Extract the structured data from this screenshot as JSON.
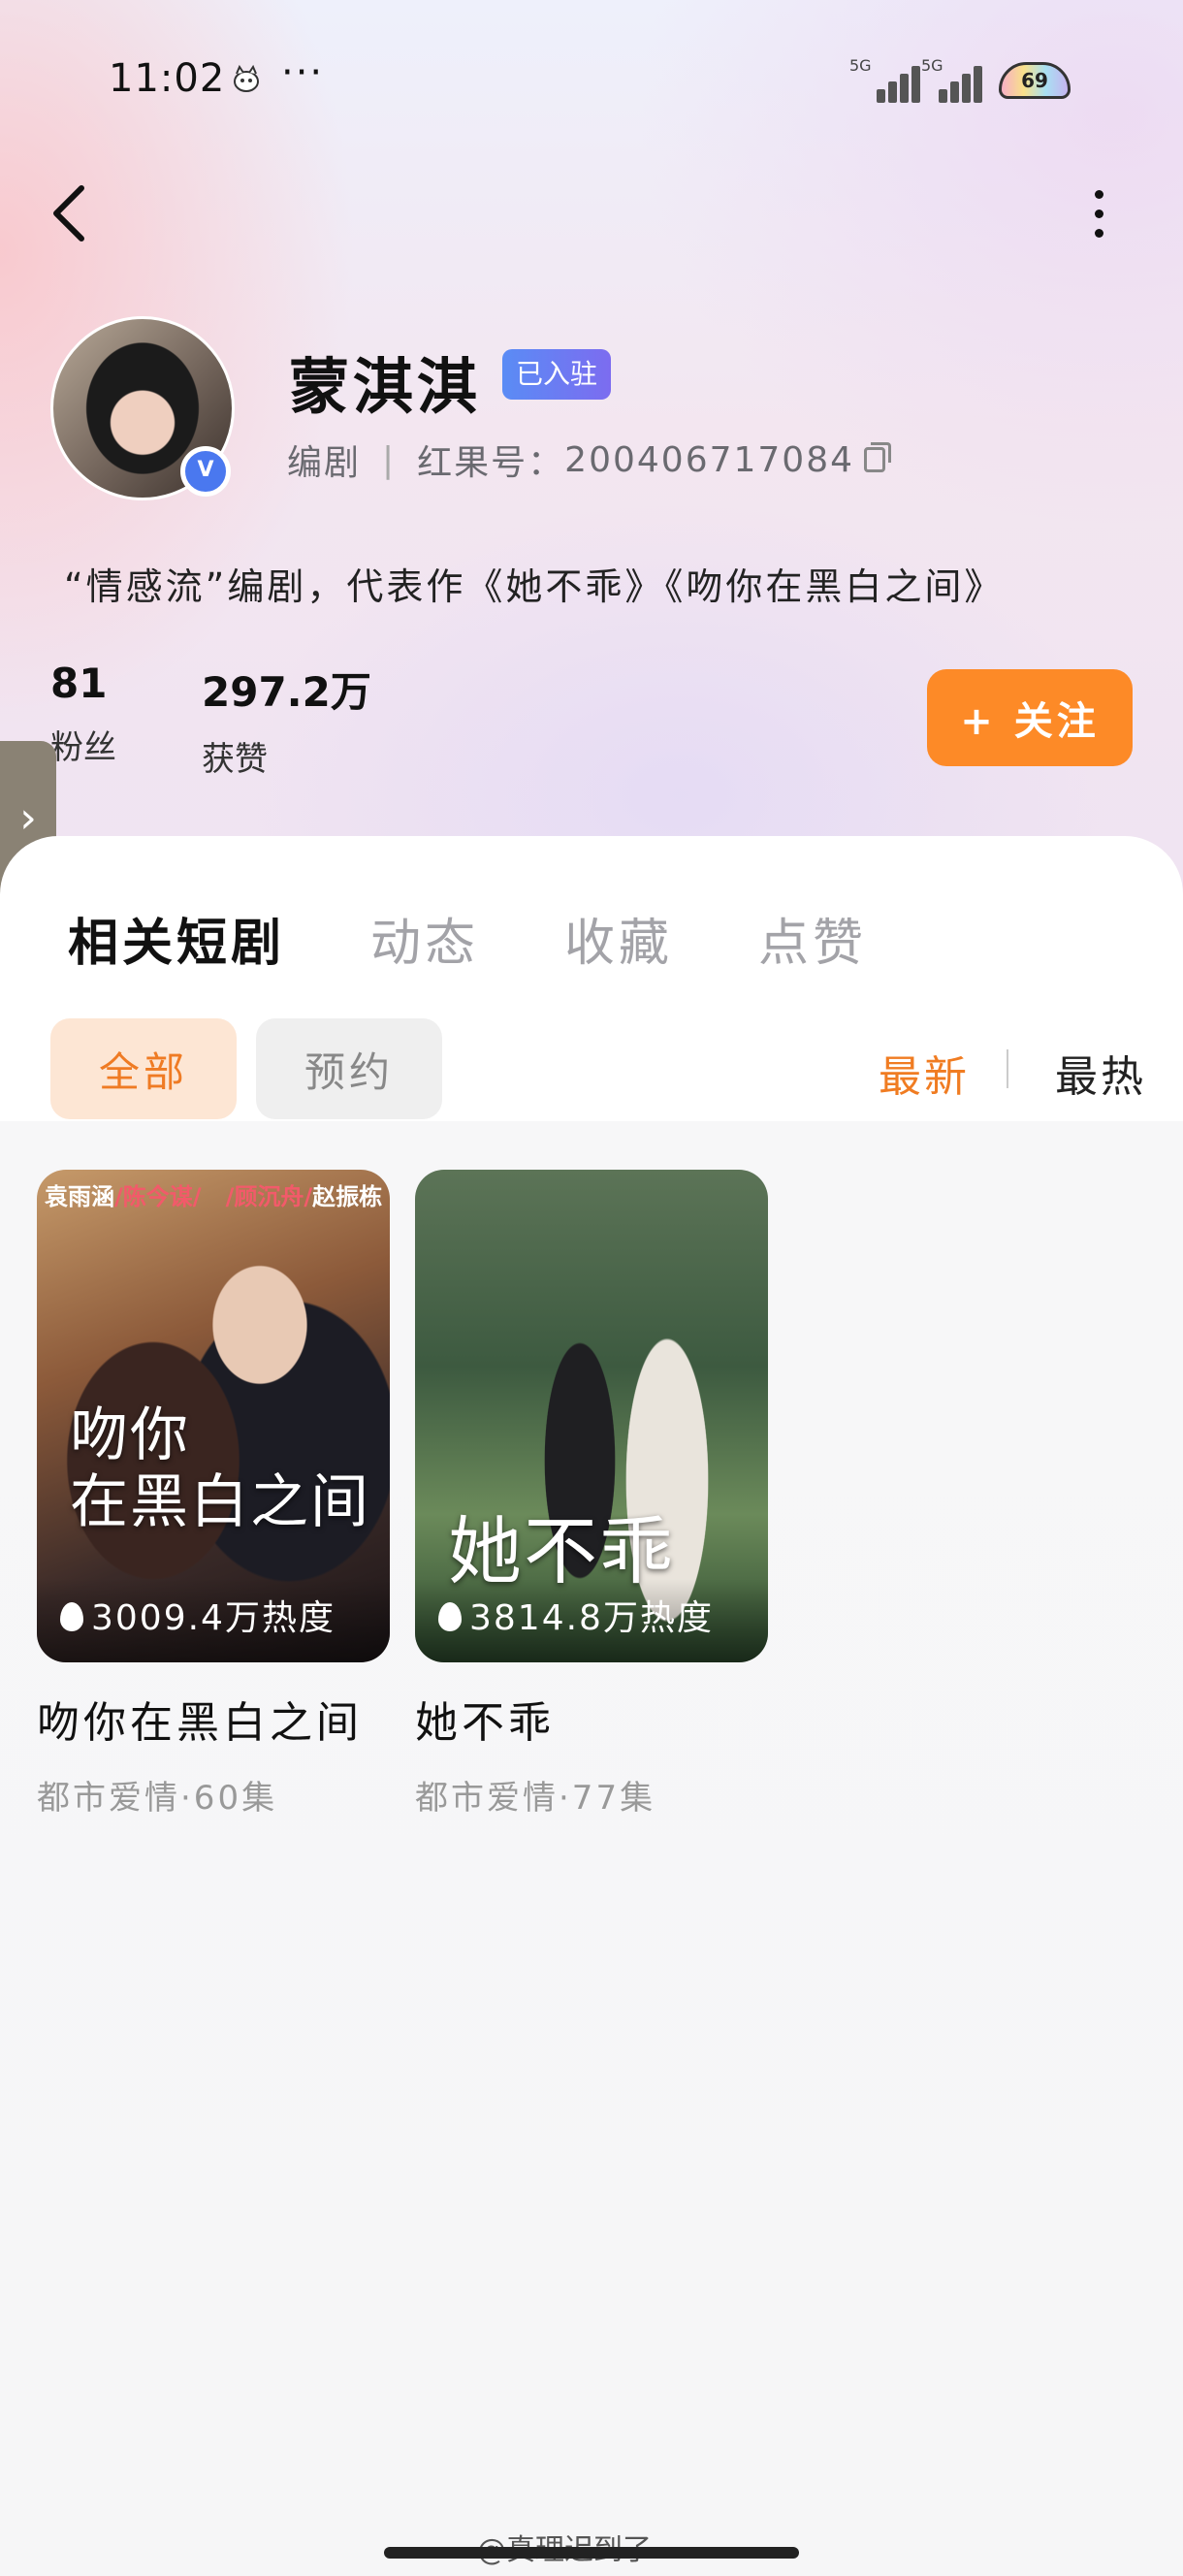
{
  "status_bar": {
    "time": "11:02",
    "dots": "···",
    "signal_1": "5G",
    "signal_2": "5G",
    "battery": "69"
  },
  "profile": {
    "name": "蒙淇淇",
    "badge": "已入驻",
    "role": "编剧",
    "id_label": "红果号：",
    "id_value": "200406717084",
    "bio": "“情感流”编剧，代表作《她不乖》《吻你在黑白之间》",
    "verified_mark": "V",
    "stats": [
      {
        "value": "81",
        "label": "粉丝"
      },
      {
        "value": "297.2万",
        "label": "获赞"
      }
    ],
    "follow_label": "+ 关注"
  },
  "tabs": [
    {
      "label": "相关短剧",
      "active": true
    },
    {
      "label": "动态",
      "active": false
    },
    {
      "label": "收藏",
      "active": false
    },
    {
      "label": "点赞",
      "active": false
    }
  ],
  "filters": {
    "all": "全部",
    "reserve": "预约"
  },
  "sort": {
    "newest": "最新",
    "hottest": "最热"
  },
  "dramas": [
    {
      "poster_cast_a": "袁雨涵",
      "poster_cast_b": "/陈今谋/",
      "poster_cast_c": "/顾沉舟/",
      "poster_cast_d": "赵振栋",
      "poster_title": "吻你\n在黑白之间",
      "heat": "3009.4万热度",
      "title": "吻你在黑白之间",
      "meta": "都市爱情·60集"
    },
    {
      "poster_title": "她不乖",
      "heat": "3814.8万热度",
      "title": "她不乖",
      "meta": "都市爱情·77集"
    }
  ],
  "watermark": "@真理迟到了",
  "colors": {
    "accent": "#fd8a27",
    "verified": "#4a78ef"
  }
}
